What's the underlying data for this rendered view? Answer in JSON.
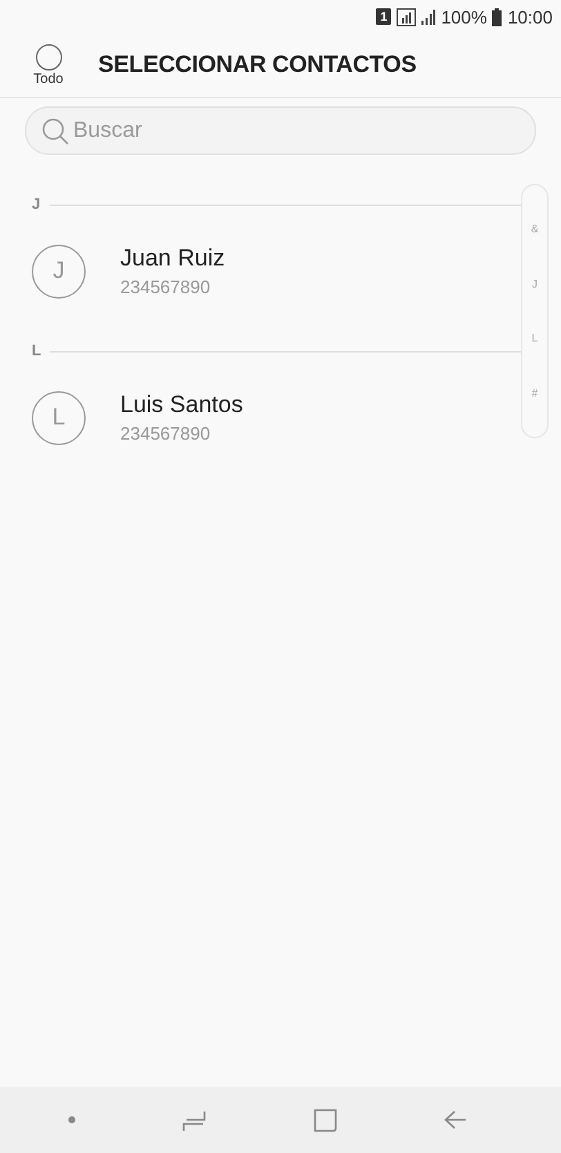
{
  "status_bar": {
    "sim": "1",
    "battery_text": "100%",
    "time": "10:00"
  },
  "header": {
    "select_all": {
      "label": "Todo",
      "checked": false
    },
    "title": "SELECCIONAR CONTACTOS"
  },
  "search": {
    "placeholder": "Buscar"
  },
  "sections": [
    {
      "letter": "J",
      "contacts": [
        {
          "initial": "J",
          "name": "Juan Ruiz",
          "number": "234567890"
        }
      ]
    },
    {
      "letter": "L",
      "contacts": [
        {
          "initial": "L",
          "name": "Luis Santos",
          "number": "234567890"
        }
      ]
    }
  ],
  "index_bar": [
    "&",
    "J",
    "L",
    "#"
  ]
}
